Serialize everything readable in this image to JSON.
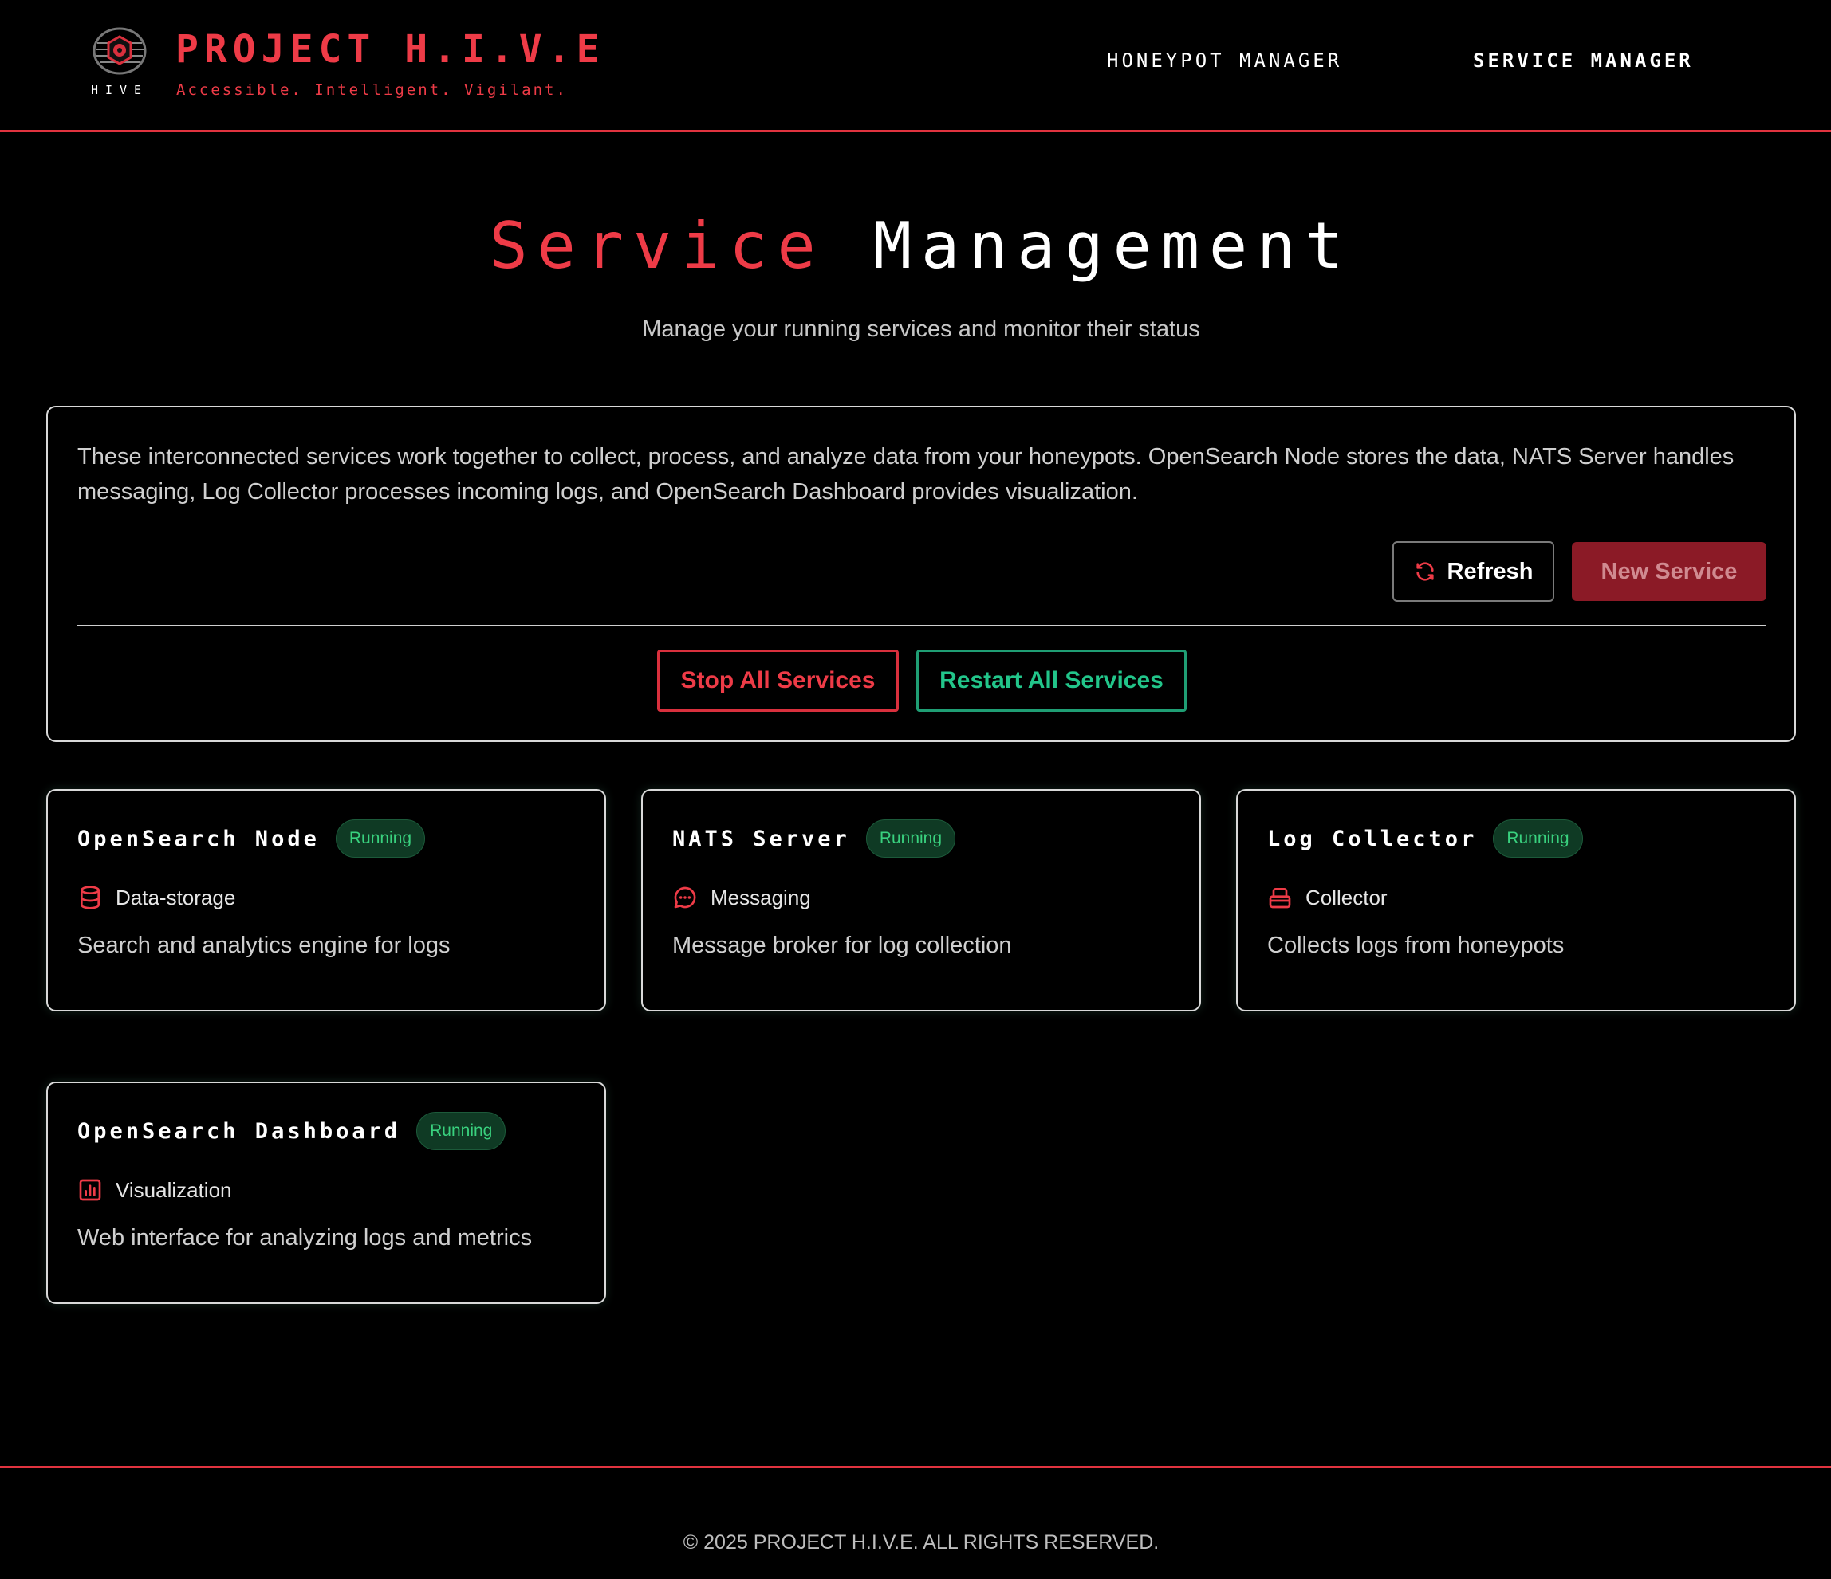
{
  "header": {
    "logo_word": "HIVE",
    "title": "PROJECT H.I.V.E",
    "tagline": "Accessible. Intelligent. Vigilant.",
    "nav": [
      {
        "label": "HONEYPOT MANAGER",
        "active": false
      },
      {
        "label": "SERVICE MANAGER",
        "active": true
      }
    ]
  },
  "hero": {
    "title_accent": "Service",
    "title_main": "Management",
    "subtitle": "Manage your running services and monitor their status"
  },
  "panel": {
    "description": "These interconnected services work together to collect, process, and analyze data from your honeypots. OpenSearch Node stores the data, NATS Server handles messaging, Log Collector processes incoming logs, and OpenSearch Dashboard provides visualization.",
    "refresh_label": "Refresh",
    "refresh_icon": "refresh-icon",
    "new_service_label": "New Service",
    "stop_all_label": "Stop All Services",
    "restart_all_label": "Restart All Services"
  },
  "services": [
    {
      "name": "OpenSearch Node",
      "status": "Running",
      "category": "Data-storage",
      "icon": "database-icon",
      "description": "Search and analytics engine for logs"
    },
    {
      "name": "NATS Server",
      "status": "Running",
      "category": "Messaging",
      "icon": "message-icon",
      "description": "Message broker for log collection"
    },
    {
      "name": "Log Collector",
      "status": "Running",
      "category": "Collector",
      "icon": "inbox-icon",
      "description": "Collects logs from honeypots"
    },
    {
      "name": "OpenSearch Dashboard",
      "status": "Running",
      "category": "Visualization",
      "icon": "bar-chart-icon",
      "description": "Web interface for analyzing logs and metrics"
    }
  ],
  "footer": {
    "copyright": "© 2025 PROJECT H.I.V.E. ALL RIGHTS RESERVED."
  },
  "colors": {
    "accent": "#ee3b47",
    "running_badge": "#39d17e",
    "restart": "#22c58a",
    "new_service_bg": "#8b1a26"
  }
}
